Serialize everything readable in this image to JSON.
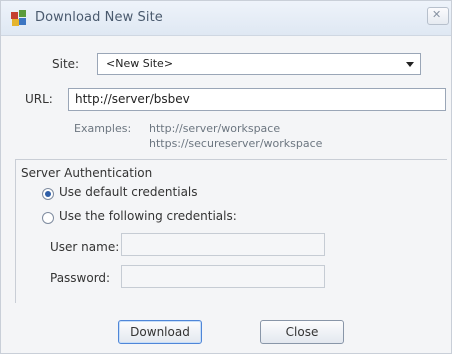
{
  "window": {
    "title": "Download New Site"
  },
  "site": {
    "label": "Site:",
    "selected": "<New Site>"
  },
  "url": {
    "label": "URL:",
    "value": "http://server/bsbev",
    "examples_label": "Examples:",
    "example_1": "http://server/workspace",
    "example_2": "https://secureserver/workspace"
  },
  "auth": {
    "section_title": "Server Authentication",
    "option_default": "Use default credentials",
    "option_following": "Use the following credentials:",
    "username_label": "User name:",
    "password_label": "Password:"
  },
  "buttons": {
    "download": "Download",
    "close": "Close"
  }
}
